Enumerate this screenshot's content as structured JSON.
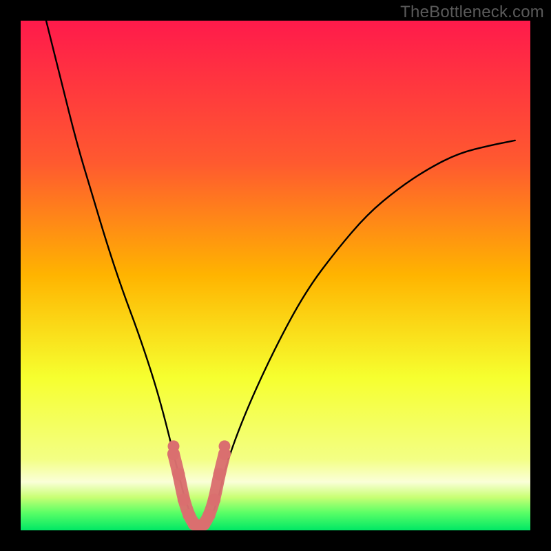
{
  "watermark": "TheBottleneck.com",
  "colors": {
    "frame": "#000000",
    "watermark": "#5a5a5a",
    "curve": "#000000",
    "marker_fill": "#da6f6f",
    "marker_stroke": "#da6f6f",
    "gradient_top": "#ff1a4b",
    "gradient_mid1": "#ff7a2a",
    "gradient_mid2": "#ffd400",
    "gradient_yellow": "#f6ff2f",
    "gradient_band": "#faffb0",
    "gradient_green1": "#b6ff60",
    "gradient_green2": "#00e765"
  },
  "chart_data": {
    "type": "line",
    "title": "",
    "xlabel": "",
    "ylabel": "",
    "xlim": [
      0,
      100
    ],
    "ylim": [
      0,
      100
    ],
    "series": [
      {
        "name": "bottleneck-curve",
        "x": [
          5,
          8,
          11,
          14,
          17,
          20,
          23,
          26,
          28,
          30,
          31,
          32,
          33,
          34,
          35,
          36,
          37,
          38,
          39,
          40,
          44,
          50,
          56,
          62,
          68,
          74,
          80,
          86,
          92,
          97
        ],
        "y": [
          100,
          88,
          76,
          66,
          56,
          47,
          39,
          30,
          23,
          15,
          11,
          7,
          4,
          2,
          0.8,
          0.8,
          2,
          4,
          7,
          12,
          23,
          36,
          47,
          55,
          62,
          67,
          71,
          74,
          75.5,
          76.5
        ]
      }
    ],
    "markers": {
      "name": "bottom-cluster",
      "points": [
        {
          "x": 30.0,
          "y": 15.0
        },
        {
          "x": 31.0,
          "y": 11.0
        },
        {
          "x": 32.0,
          "y": 6.0
        },
        {
          "x": 33.0,
          "y": 3.0
        },
        {
          "x": 34.0,
          "y": 1.2
        },
        {
          "x": 35.0,
          "y": 0.8
        },
        {
          "x": 36.0,
          "y": 1.2
        },
        {
          "x": 37.0,
          "y": 3.0
        },
        {
          "x": 38.0,
          "y": 6.0
        },
        {
          "x": 39.0,
          "y": 11.0
        },
        {
          "x": 40.0,
          "y": 15.0
        }
      ],
      "thick_path": true,
      "thick_width": 18
    },
    "background_gradient": {
      "stops": [
        {
          "offset": 0.0,
          "color": "#ff1a4b"
        },
        {
          "offset": 0.28,
          "color": "#ff5a2f"
        },
        {
          "offset": 0.5,
          "color": "#ffb400"
        },
        {
          "offset": 0.7,
          "color": "#f6ff2f"
        },
        {
          "offset": 0.86,
          "color": "#f3ff84"
        },
        {
          "offset": 0.905,
          "color": "#faffd8"
        },
        {
          "offset": 0.935,
          "color": "#c9ff74"
        },
        {
          "offset": 0.965,
          "color": "#5bff66"
        },
        {
          "offset": 1.0,
          "color": "#00e765"
        }
      ]
    }
  }
}
